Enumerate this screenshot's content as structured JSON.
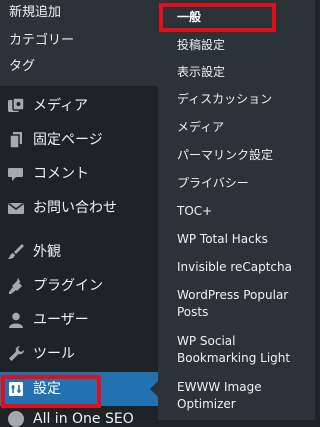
{
  "sidebar": {
    "submenu_items": [
      "新規追加",
      "カテゴリー",
      "タグ"
    ],
    "items": [
      {
        "label": "メディア",
        "icon": "media-icon"
      },
      {
        "label": "固定ページ",
        "icon": "page-icon"
      },
      {
        "label": "コメント",
        "icon": "comment-icon"
      },
      {
        "label": "お問い合わせ",
        "icon": "mail-icon"
      },
      {
        "label": "外観",
        "icon": "paintbrush-icon"
      },
      {
        "label": "プラグイン",
        "icon": "plugin-icon"
      },
      {
        "label": "ユーザー",
        "icon": "user-icon"
      },
      {
        "label": "ツール",
        "icon": "wrench-icon"
      },
      {
        "label": "設定",
        "icon": "settings-icon",
        "current": true
      }
    ],
    "partial_item": {
      "label": "All in One SEO"
    }
  },
  "settings_submenu": {
    "items": [
      "一般",
      "投稿設定",
      "表示設定",
      "ディスカッション",
      "メディア",
      "パーマリンク設定",
      "プライバシー",
      "TOC+",
      "WP Total Hacks",
      "Invisible reCaptcha",
      "WordPress Popular Posts",
      "WP Social Bookmarking Light",
      "EWWW Image Optimizer"
    ],
    "current_index": 0
  },
  "colors": {
    "menu_bg": "#1d2327",
    "submenu_bg": "#2c3338",
    "current_bg": "#2271b1",
    "text": "#f0f0f1",
    "annotation": "#e0101a"
  }
}
